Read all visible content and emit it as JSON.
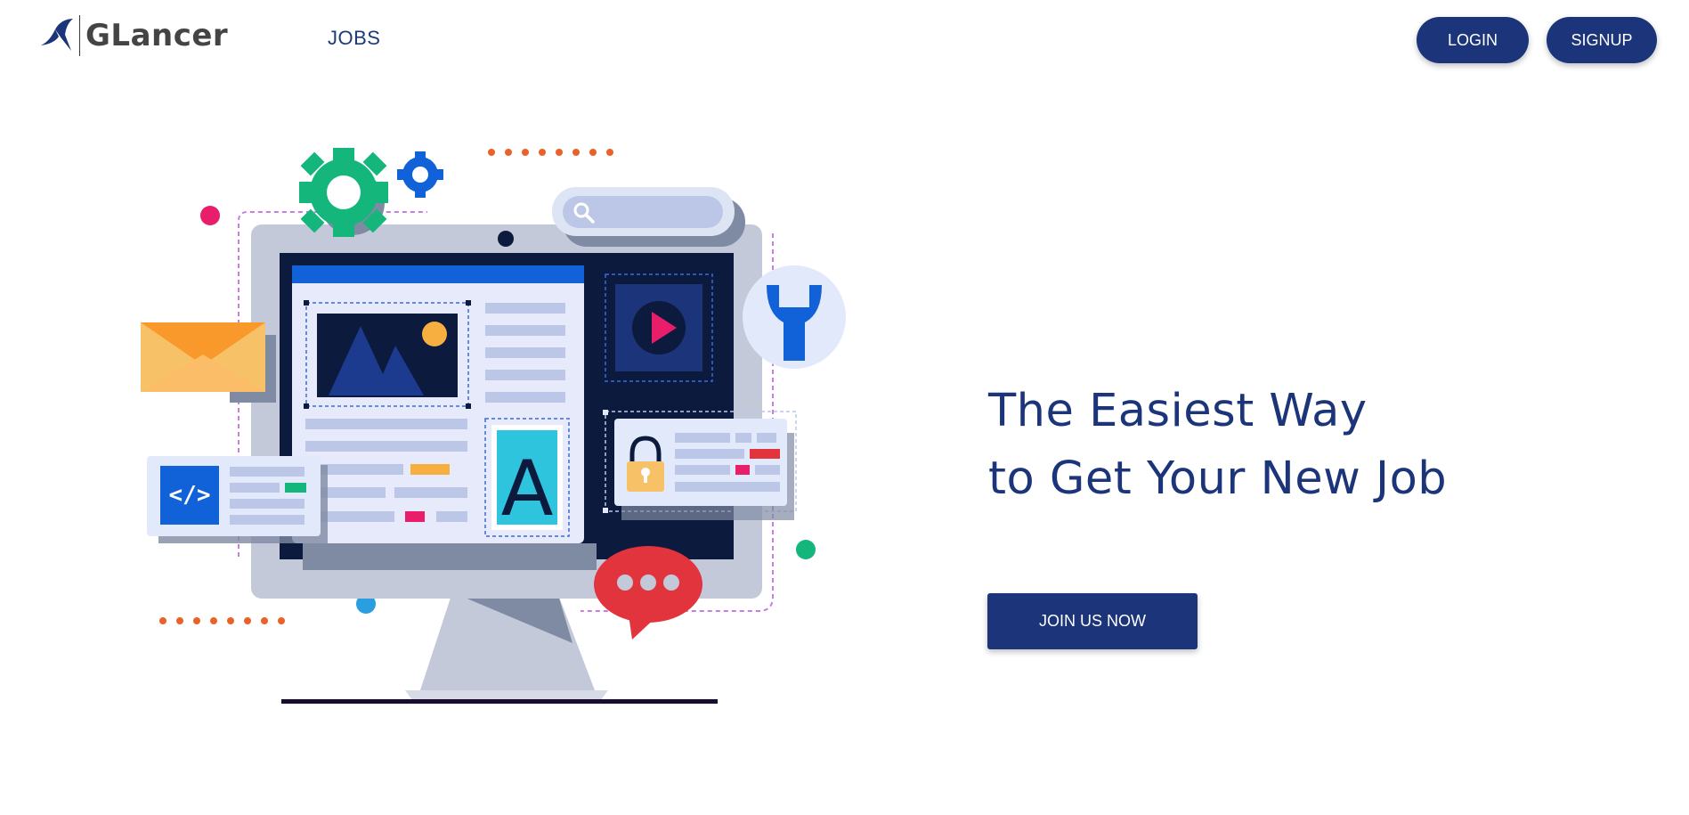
{
  "brand": {
    "name": "GLancer"
  },
  "nav": {
    "jobs_label": "JOBS"
  },
  "auth": {
    "login_label": "LOGIN",
    "signup_label": "SIGNUP"
  },
  "hero": {
    "headline_line1": "The Easiest Way",
    "headline_line2": "to Get Your New Job",
    "cta_label": "JOIN US NOW",
    "illustration": {
      "letter_tile": "A",
      "code_tag": "</>"
    }
  },
  "colors": {
    "primary": "#1c357a",
    "background": "#ffffff"
  }
}
